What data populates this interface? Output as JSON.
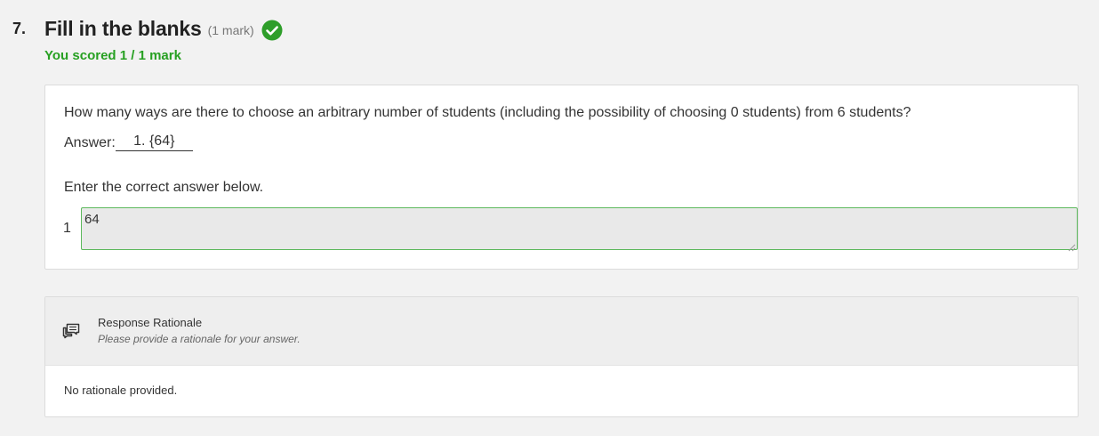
{
  "question": {
    "number": "7.",
    "title": "Fill in the blanks",
    "marks": "(1 mark)",
    "score_text": "You scored 1 / 1 mark",
    "status_icon": "check-circle-icon",
    "prompt": "How many ways are there to choose an arbitrary number of students (including the possibility of choosing 0 students) from 6 students?",
    "answer_label": "Answer:",
    "answer_blank": "1. {64}",
    "enter_label": "Enter the correct answer below.",
    "inputs": [
      {
        "index": "1",
        "value": "64"
      }
    ]
  },
  "rationale": {
    "icon": "comments-icon",
    "title": "Response Rationale",
    "subtitle": "Please provide a rationale for your answer.",
    "body": "No rationale provided."
  },
  "colors": {
    "success": "#27a022",
    "check_fill": "#2e9e2a",
    "input_border": "#5cb85c",
    "input_bg": "#e9e9e9",
    "page_bg": "#f2f2f2"
  }
}
